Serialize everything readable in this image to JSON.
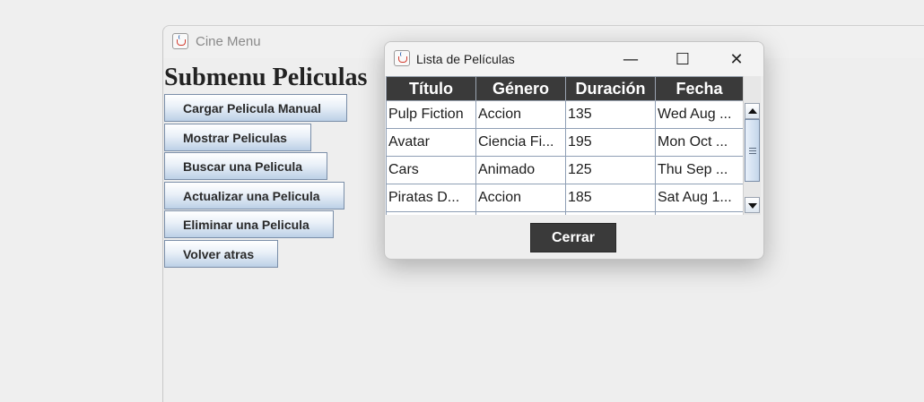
{
  "main_window": {
    "title": "Cine Menu",
    "heading": "Submenu Peliculas",
    "buttons": [
      {
        "label": "Cargar Pelicula Manual"
      },
      {
        "label": "Mostrar Peliculas"
      },
      {
        "label": "Buscar una Pelicula"
      },
      {
        "label": "Actualizar una Pelicula"
      },
      {
        "label": "Eliminar una Pelicula"
      },
      {
        "label": "Volver atras"
      }
    ]
  },
  "dialog": {
    "title": "Lista de Películas",
    "controls": {
      "minimize": "—",
      "maximize": "☐",
      "close": "✕"
    },
    "table": {
      "columns": [
        "Título",
        "Género",
        "Duración",
        "Fecha"
      ],
      "rows": [
        [
          "Pulp Fiction",
          "Accion",
          "135",
          "Wed Aug ..."
        ],
        [
          "Avatar",
          "Ciencia Fi...",
          "195",
          "Mon Oct ..."
        ],
        [
          "Cars",
          "Animado",
          "125",
          "Thu Sep ..."
        ],
        [
          "Piratas D...",
          "Accion",
          "185",
          "Sat Aug 1..."
        ]
      ]
    },
    "close_button": "Cerrar"
  },
  "colors": {
    "header_bg": "#3a3a3a",
    "header_text": "#ffffff",
    "button_border": "#7a8ea8",
    "window_bg": "#eeeeee"
  },
  "icons": {
    "app_icon": "java-cup-icon"
  }
}
